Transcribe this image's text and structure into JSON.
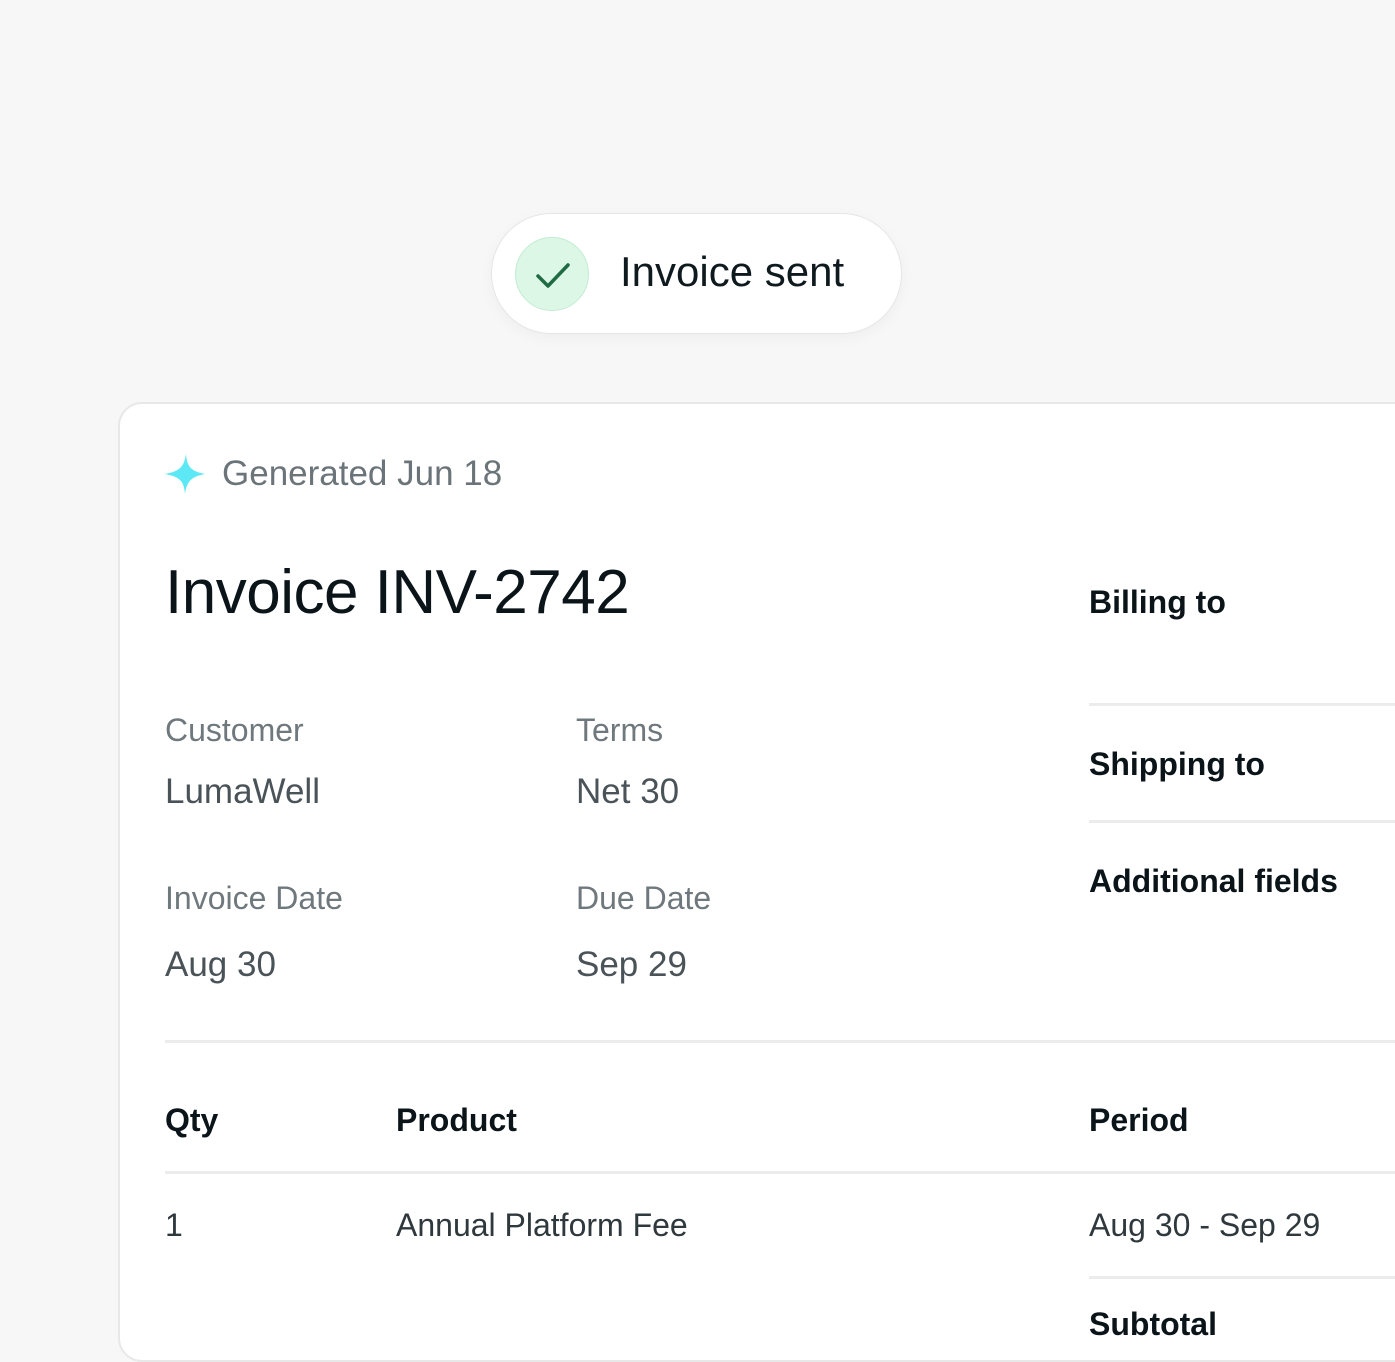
{
  "toast": {
    "message": "Invoice sent",
    "icon": "check-icon"
  },
  "invoice": {
    "generated_label": "Generated Jun 18",
    "title": "Invoice INV-2742",
    "fields": {
      "customer_label": "Customer",
      "customer_value": "LumaWell",
      "terms_label": "Terms",
      "terms_value": "Net 30",
      "invoice_date_label": "Invoice Date",
      "invoice_date_value": "Aug 30",
      "due_date_label": "Due Date",
      "due_date_value": "Sep 29"
    },
    "sections": {
      "billing": "Billing to",
      "shipping": "Shipping to",
      "additional": "Additional fields"
    },
    "table": {
      "headers": {
        "qty": "Qty",
        "product": "Product",
        "period": "Period"
      },
      "rows": [
        {
          "qty": "1",
          "product": "Annual Platform Fee",
          "period": "Aug 30 - Sep 29"
        }
      ],
      "subtotal_label": "Subtotal"
    }
  },
  "colors": {
    "accent_sparkle": "#5ce8f5",
    "success_bg": "#dcf7e6",
    "success_check": "#1f6b43"
  }
}
